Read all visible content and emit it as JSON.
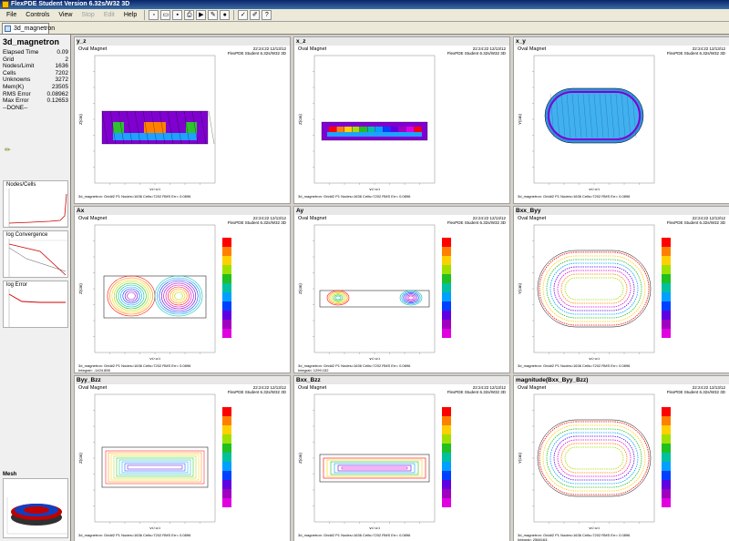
{
  "window": {
    "title": "FlexPDE Student Version 6.32s/W32 3D"
  },
  "menu": {
    "file": "File",
    "controls": "Controls",
    "view": "View",
    "stop": "Stop",
    "edit": "Edit",
    "help": "Help"
  },
  "tab": {
    "label": "3d_magnetron"
  },
  "status": {
    "problem": "3d_magnetron",
    "rows": [
      {
        "label": "Elapsed Time",
        "value": "0.09"
      },
      {
        "label": "Grid",
        "value": "2"
      },
      {
        "label": "Nodes/Limit",
        "value": "1636"
      },
      {
        "label": "Cells",
        "value": "7202"
      },
      {
        "label": "Unknowns",
        "value": "3272"
      },
      {
        "label": "Mem(K)",
        "value": "23505"
      },
      {
        "label": "RMS Error",
        "value": "0.08962"
      },
      {
        "label": "Max Error",
        "value": "0.12653"
      }
    ],
    "done": "--DONE--"
  },
  "monitors": {
    "nodes": "Nodes/Cells",
    "conv": "log Convergence",
    "error": "log Error",
    "mesh": "Mesh"
  },
  "panels": [
    {
      "title": "y_z",
      "sub": "Oval Magnet",
      "xlabel": "Y(cm)",
      "ylabel": "Z(cm)",
      "footer": "3d_magnetron:  Grid#2  P1  Nodes=1636  Cells=7202  RMS Err= 0.0896",
      "integral": ""
    },
    {
      "title": "x_z",
      "sub": "Oval Magnet",
      "xlabel": "X(cm)",
      "ylabel": "Z(cm)",
      "footer": "3d_magnetron:  Grid#2  P1  Nodes=1636  Cells=7202  RMS Err= 0.0896",
      "integral": ""
    },
    {
      "title": "x_y",
      "sub": "Oval Magnet",
      "xlabel": "X(cm)",
      "ylabel": "Y(cm)",
      "footer": "3d_magnetron:  Grid#2  P1  Nodes=1636  Cells=7202  RMS Err= 0.0896",
      "integral": ""
    },
    {
      "title": "Ax",
      "sub": "Oval Magnet",
      "xlabel": "Y(cm)",
      "ylabel": "Z(cm)",
      "footer": "3d_magnetron:  Grid#2  P1  Nodes=1636  Cells=7202  RMS Err= 0.0896",
      "integral": "Integral= -1424.855"
    },
    {
      "title": "Ay",
      "sub": "Oval Magnet",
      "xlabel": "X(cm)",
      "ylabel": "Z(cm)",
      "footer": "3d_magnetron:  Grid#2  P1  Nodes=1636  Cells=7202  RMS Err= 0.0896",
      "integral": "Integral= 1299.152"
    },
    {
      "title": "Bxx_Byy",
      "sub": "Oval Magnet",
      "xlabel": "X(cm)",
      "ylabel": "Y(cm)",
      "footer": "3d_magnetron:  Grid#2  P1  Nodes=1636  Cells=7202  RMS Err= 0.0896",
      "integral": ""
    },
    {
      "title": "Byy_Bzz",
      "sub": "Oval Magnet",
      "xlabel": "Y(cm)",
      "ylabel": "Z(cm)",
      "footer": "3d_magnetron:  Grid#2  P1  Nodes=1636  Cells=7202  RMS Err= 0.0896",
      "integral": ""
    },
    {
      "title": "Bxx_Bzz",
      "sub": "Oval Magnet",
      "xlabel": "X(cm)",
      "ylabel": "Z(cm)",
      "footer": "3d_magnetron:  Grid#2  P1  Nodes=1636  Cells=7202  RMS Err= 0.0896",
      "integral": ""
    },
    {
      "title": "magnitude(Bxx_Byy_Bzz)",
      "sub": "Oval Magnet",
      "xlabel": "X(cm)",
      "ylabel": "Y(cm)",
      "footer": "3d_magnetron:  Grid#2  P1  Nodes=1636  Cells=7202  RMS Err= 0.0896",
      "integral": "Integral= 2566163."
    }
  ],
  "date": "22:24:22 12/13/12",
  "version": "FlexPDE Student 6.32s/W32 3D"
}
